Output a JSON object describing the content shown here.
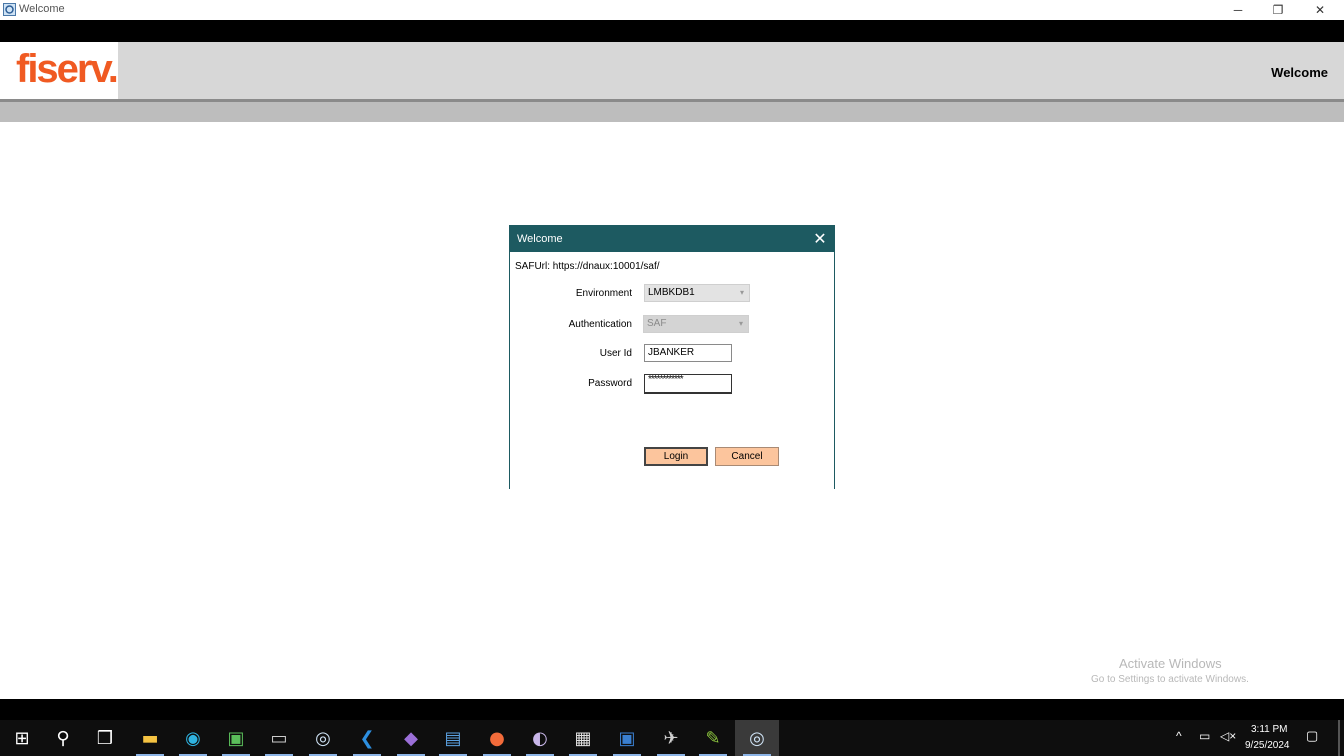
{
  "window": {
    "title": "Welcome",
    "minimize": "─",
    "restore": "❐",
    "close": "✕"
  },
  "header": {
    "logo": "fiserv.",
    "title": "Welcome"
  },
  "dialog": {
    "title": "Welcome",
    "close": "✕",
    "saf_url": "SAFUrl: https://dnaux:10001/saf/",
    "environment_label": "Environment",
    "environment_value": "LMBKDB1",
    "authentication_label": "Authentication",
    "authentication_value": "SAF",
    "user_id_label": "User Id",
    "user_id_value": "JBANKER",
    "password_label": "Password",
    "password_value": "************",
    "login_label": "Login",
    "cancel_label": "Cancel"
  },
  "watermark": {
    "line1": "Activate Windows",
    "line2": "Go to Settings to activate Windows."
  },
  "taskbar": {
    "items": [
      {
        "name": "start-icon",
        "glyph": "⊞",
        "color": "#ffffff"
      },
      {
        "name": "search-icon",
        "glyph": "⚲",
        "color": "#ffffff"
      },
      {
        "name": "task-view-icon",
        "glyph": "❒",
        "color": "#ffffff"
      },
      {
        "name": "file-explorer-icon",
        "glyph": "▬",
        "color": "#f5c342"
      },
      {
        "name": "edge-icon",
        "glyph": "◉",
        "color": "#2fb3e0"
      },
      {
        "name": "app-icon",
        "glyph": "▣",
        "color": "#5bbf5b"
      },
      {
        "name": "terminal-icon",
        "glyph": "▭",
        "color": "#cccccc"
      },
      {
        "name": "fiserv-app-icon",
        "glyph": "◎",
        "color": "#cfe3f5"
      },
      {
        "name": "vscode-icon",
        "glyph": "❮",
        "color": "#2d8fe0"
      },
      {
        "name": "visual-studio-icon",
        "glyph": "◆",
        "color": "#9b6fd8"
      },
      {
        "name": "document-app-icon",
        "glyph": "▤",
        "color": "#5aa0e0"
      },
      {
        "name": "postman-icon",
        "glyph": "●",
        "color": "#f26b3a"
      },
      {
        "name": "eclipse-icon",
        "glyph": "◐",
        "color": "#c8b6e8"
      },
      {
        "name": "window-app-icon",
        "glyph": "▦",
        "color": "#e0e0e0"
      },
      {
        "name": "blue-app-icon",
        "glyph": "▣",
        "color": "#3a7fd0"
      },
      {
        "name": "remote-app-icon",
        "glyph": "✈",
        "color": "#d0d0d0"
      },
      {
        "name": "notepad-icon",
        "glyph": "✎",
        "color": "#8dc63f"
      },
      {
        "name": "welcome-app-icon",
        "glyph": "◎",
        "color": "#cfe3f5"
      }
    ],
    "tray_up": "^",
    "tray_network": "▭",
    "tray_volume": "◁×",
    "time": "3:11 PM",
    "date": "9/25/2024",
    "notifications": "▢"
  }
}
